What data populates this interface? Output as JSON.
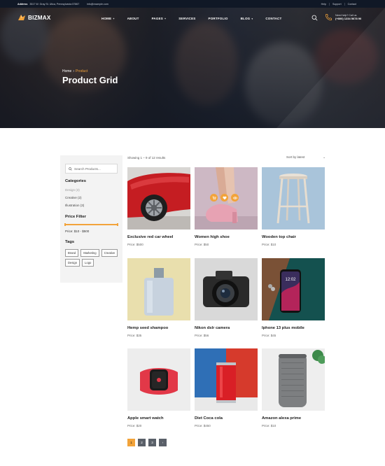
{
  "topbar": {
    "address_label": "Address",
    "address_value": "3517 W. Gray St. Utica, Pennsylvania 57867",
    "email": "info@example.com",
    "links": [
      "Help",
      "Support",
      "Contact"
    ]
  },
  "brand": {
    "name": "BIZMAX",
    "accent_color": "#f2a33a"
  },
  "nav": {
    "items": [
      {
        "label": "HOME",
        "has_dropdown": true
      },
      {
        "label": "ABOUT",
        "has_dropdown": false
      },
      {
        "label": "PAGES",
        "has_dropdown": true
      },
      {
        "label": "SERVICES",
        "has_dropdown": false
      },
      {
        "label": "PORTFOLIO",
        "has_dropdown": false
      },
      {
        "label": "BLOG",
        "has_dropdown": true
      },
      {
        "label": "CONTACT",
        "has_dropdown": false
      }
    ],
    "dropdown_glyph": "▾",
    "plus_glyph": "+",
    "phone_label": "Need help? Call us",
    "phone_number": "(+800) 1234 5678 90"
  },
  "hero": {
    "breadcrumb": {
      "home": "Home",
      "separator": "›",
      "current": "Product"
    },
    "title": "Product Grid"
  },
  "sidebar": {
    "search_placeholder": "Search Products...",
    "categories_heading": "Categories",
    "categories": [
      {
        "label": "Design (3)",
        "dim": true
      },
      {
        "label": "Creative (2)",
        "dim": false
      },
      {
        "label": "Illustration (3)",
        "dim": false
      }
    ],
    "price_heading": "Price Filter",
    "price_range": "Price: $10 - $500",
    "price_slider_fill": 1.0,
    "tags_heading": "Tags",
    "tags": [
      "Brand",
      "Marketing",
      "Creative",
      "Design",
      "Logo"
    ]
  },
  "listing": {
    "showing_text": "Showing 1 – 9 of 12 results",
    "sort_label": "Sort by latest",
    "sort_caret": "⌄"
  },
  "products": [
    {
      "name": "Exclusive red car wheel",
      "price": "Price: $500",
      "image": "red-car-wheel"
    },
    {
      "name": "Women high shoe",
      "price": "Price: $50",
      "image": "pink-high-shoe"
    },
    {
      "name": "Wooden top chair",
      "price": "Price: $10",
      "image": "wooden-stool"
    },
    {
      "name": "Hemp seed shampoo",
      "price": "Price: $35",
      "image": "shampoo-bottle"
    },
    {
      "name": "Nikon dslr camera",
      "price": "Price: $56",
      "image": "dslr-camera"
    },
    {
      "name": "Iphone 13 plus mobile",
      "price": "Price: $45",
      "image": "smartphone"
    },
    {
      "name": "Apple smart watch",
      "price": "Price: $20",
      "image": "smart-watch"
    },
    {
      "name": "Diet Coca cola",
      "price": "Price: $450",
      "image": "cola-can"
    },
    {
      "name": "Amazon alexa prime",
      "price": "Price: $10",
      "image": "smart-speaker"
    }
  ],
  "pagination": {
    "pages": [
      "1",
      "2",
      "3"
    ],
    "active": "1",
    "next": "›"
  }
}
